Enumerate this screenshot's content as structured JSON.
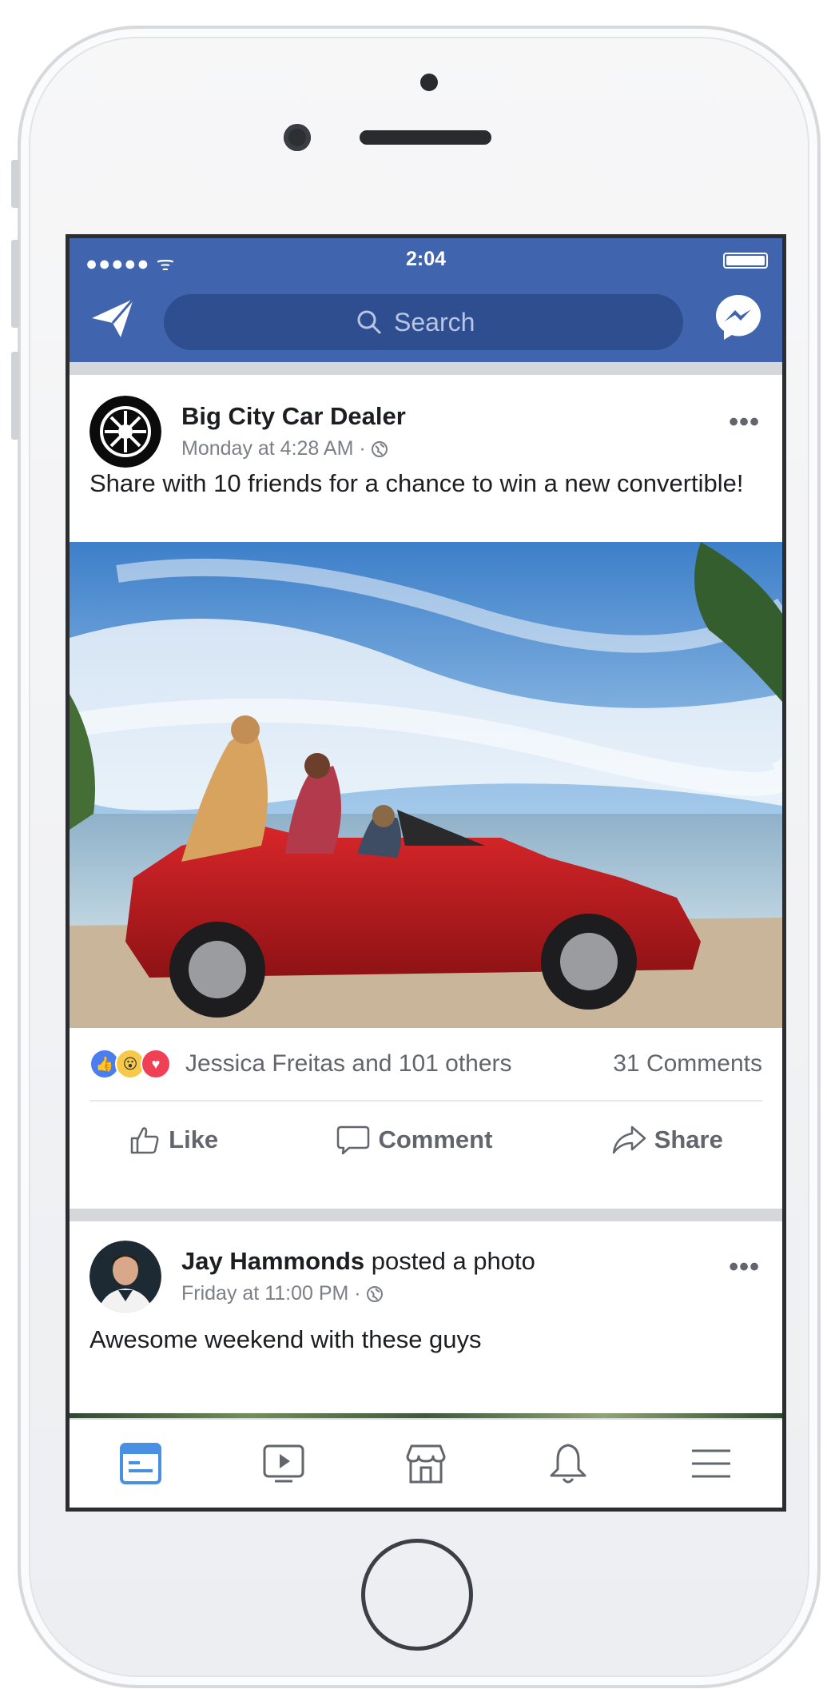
{
  "status_bar": {
    "signal": "●●●●● ᯤ",
    "time": "2:04"
  },
  "search": {
    "placeholder": "Search"
  },
  "posts": [
    {
      "author": "Big City Car Dealer",
      "action": "",
      "meta": "Monday at 4:28 AM ·",
      "text": "Share with 10 friends for a chance to win a new convertible!",
      "reactions_text": "Jessica Freitas and 101 others",
      "comments_count": "31 Comments"
    },
    {
      "author": "Jay Hammonds",
      "action": " posted a photo",
      "meta": "Friday at 11:00 PM ·",
      "text": "Awesome weekend with these guys"
    }
  ],
  "more_label": "•••",
  "actions": {
    "like": "Like",
    "comment": "Comment",
    "share": "Share"
  },
  "tabs": [
    "news-feed",
    "watch",
    "marketplace",
    "notifications",
    "menu"
  ],
  "colors": {
    "brand": "#4064ad",
    "active_tab": "#4a90e2"
  }
}
